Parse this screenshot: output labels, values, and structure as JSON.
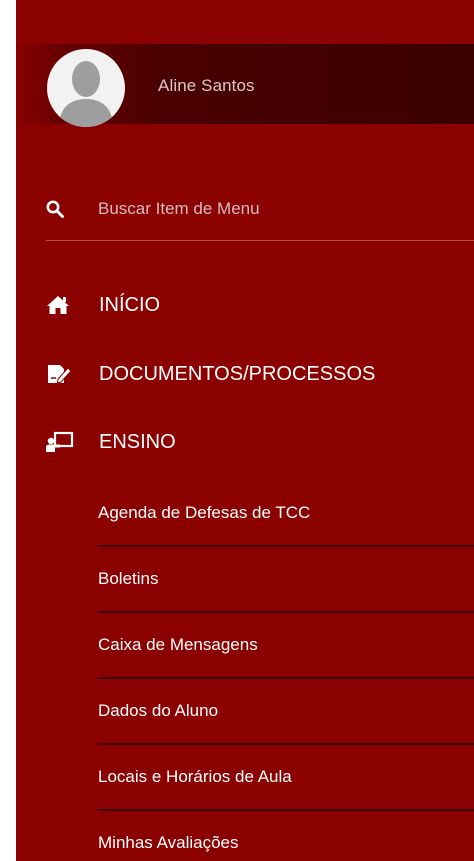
{
  "user": {
    "name": "Aline Santos"
  },
  "search": {
    "placeholder": "Buscar Item de Menu"
  },
  "menu": [
    {
      "label": "INÍCIO",
      "icon": "home-icon"
    },
    {
      "label": "DOCUMENTOS/PROCESSOS",
      "icon": "document-edit-icon"
    },
    {
      "label": "ENSINO",
      "icon": "teacher-board-icon"
    }
  ],
  "submenu": [
    {
      "label": "Agenda de Defesas de TCC"
    },
    {
      "label": "Boletins"
    },
    {
      "label": "Caixa de Mensagens"
    },
    {
      "label": "Dados do Aluno"
    },
    {
      "label": "Locais e Horários de Aula"
    },
    {
      "label": "Minhas Avaliações"
    }
  ],
  "colors": {
    "sidebar": "#8b0000",
    "user_panel": "#3a0000",
    "separator": "#3a0a0a"
  }
}
